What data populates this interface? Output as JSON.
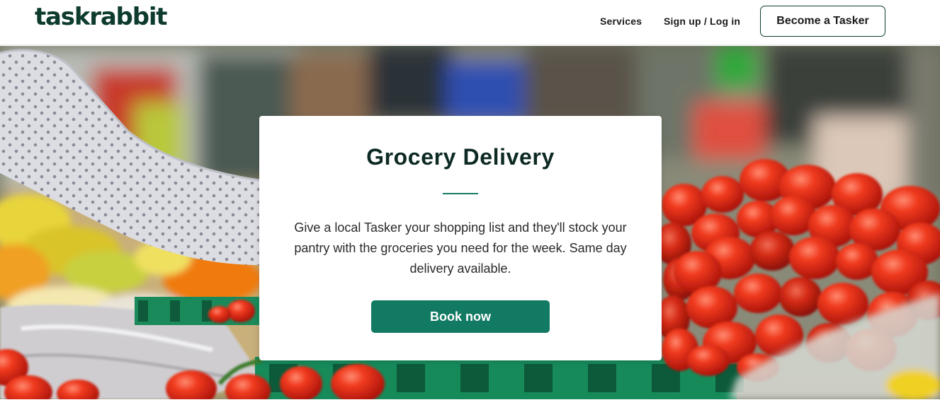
{
  "header": {
    "logo": "taskrabbit",
    "nav": {
      "services": "Services",
      "signup_login": "Sign up / Log in"
    },
    "become_tasker": "Become a Tasker"
  },
  "hero": {
    "title": "Grocery Delivery",
    "description": "Give a local Tasker your shopping list and they'll stock your pantry with the groceries you need for the week. Same day delivery available.",
    "cta": "Book now"
  },
  "colors": {
    "brand_dark_green": "#0d3b2e",
    "button_green": "#127a63"
  }
}
